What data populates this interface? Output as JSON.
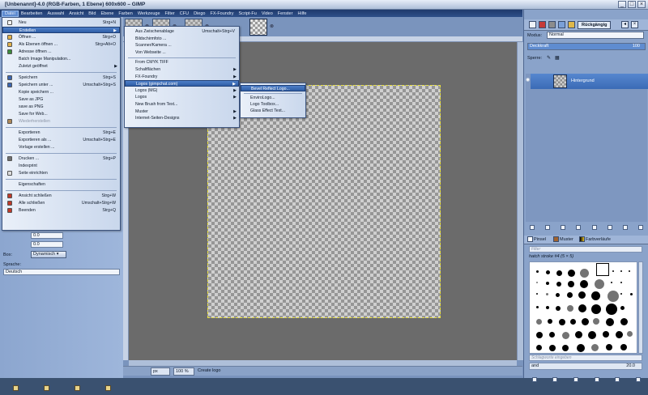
{
  "window": {
    "title": "[Unbenannt]-4.0 (RGB-Farben, 1 Ebene) 600x600 – GIMP",
    "buttons": [
      "_",
      "□",
      "×"
    ]
  },
  "menubar": [
    "Datei",
    "Bearbeiten",
    "Auswahl",
    "Ansicht",
    "Bild",
    "Ebene",
    "Farben",
    "Werkzeuge",
    "Filter",
    "CFU",
    "Diego",
    "FX-Foundry",
    "Script-Fu",
    "Video",
    "Fenster",
    "Hilfe"
  ],
  "file_menu": [
    {
      "label": "Neu",
      "acc": "Strg+N",
      "icon": "new-file-icon"
    },
    {
      "label": "Erstellen",
      "acc": "",
      "arrow": true,
      "highlighted": true
    },
    {
      "label": "Öffnen ...",
      "acc": "Strg+O",
      "icon": "open-folder-icon"
    },
    {
      "label": "Als Ebenen öffnen ...",
      "acc": "Strg+Alt+O",
      "icon": "open-layers-icon"
    },
    {
      "label": "Adresse öffnen ...",
      "acc": "",
      "icon": "globe-icon"
    },
    {
      "label": "Batch Image Manipulation...",
      "acc": ""
    },
    {
      "label": "Zuletzt geöffnet",
      "acc": "",
      "arrow": true
    },
    {
      "sep": true
    },
    {
      "label": "Speichern",
      "acc": "Strg+S",
      "icon": "save-icon"
    },
    {
      "label": "Speichern unter ...",
      "acc": "Umschalt+Strg+S",
      "icon": "save-as-icon"
    },
    {
      "label": "Kopie speichern ...",
      "acc": ""
    },
    {
      "label": "Save as JPG",
      "acc": ""
    },
    {
      "label": "save as PNG",
      "acc": ""
    },
    {
      "label": "Save for Web...",
      "acc": ""
    },
    {
      "label": "Wiederherstellen",
      "acc": "",
      "disabled": true,
      "icon": "revert-icon"
    },
    {
      "sep": true
    },
    {
      "label": "Exportieren",
      "acc": "Strg+E"
    },
    {
      "label": "Exportieren als ...",
      "acc": "Umschalt+Strg+E"
    },
    {
      "label": "Vorlage erstellen ...",
      "acc": ""
    },
    {
      "sep": true
    },
    {
      "label": "Drucken ...",
      "acc": "Strg+P",
      "icon": "print-icon"
    },
    {
      "label": "Indexprint",
      "acc": ""
    },
    {
      "label": "Seite einrichten",
      "acc": "",
      "icon": "page-setup-icon"
    },
    {
      "sep": true
    },
    {
      "label": "Eigenschaften",
      "acc": ""
    },
    {
      "sep": true
    },
    {
      "label": "Ansicht schließen",
      "acc": "Strg+W",
      "icon": "close-view-icon"
    },
    {
      "label": "Alle schließen",
      "acc": "Umschalt+Strg+W",
      "icon": "close-all-icon"
    },
    {
      "label": "Beenden",
      "acc": "Strg+Q",
      "icon": "quit-icon"
    }
  ],
  "create_menu": [
    {
      "label": "Aus Zwischenablage",
      "acc": "Umschalt+Strg+V"
    },
    {
      "label": "Bildschirmfoto ...",
      "acc": ""
    },
    {
      "label": "Scanner/Kamera ...",
      "acc": ""
    },
    {
      "label": "Von Webseite ...",
      "acc": ""
    },
    {
      "sep": true
    },
    {
      "label": "From CMYK TIFF",
      "acc": ""
    },
    {
      "label": "Schaltflächen",
      "acc": "",
      "arrow": true
    },
    {
      "label": "FX-Foundry",
      "acc": "",
      "arrow": true
    },
    {
      "label": "Logos (gimpchat.com)",
      "acc": "",
      "arrow": true,
      "highlighted": true
    },
    {
      "label": "Logos (MG)",
      "acc": "",
      "arrow": true
    },
    {
      "label": "Logos",
      "acc": "",
      "arrow": true
    },
    {
      "label": "New Brush from Text...",
      "acc": ""
    },
    {
      "label": "Muster",
      "acc": "",
      "arrow": true
    },
    {
      "label": "Internet-Seiten-Designs",
      "acc": "",
      "arrow": true
    }
  ],
  "logos_menu": [
    {
      "label": "Bevel Reflect Logo...",
      "highlighted": true
    },
    {
      "sep": true
    },
    {
      "label": "EnviroLogo..."
    },
    {
      "label": "Logo Toolbox..."
    },
    {
      "label": "Glass Effect Text..."
    }
  ],
  "left_dock": {
    "fields": [
      "0.0",
      "0.0"
    ],
    "box_label": "Box:",
    "box_value": "Dynamisch",
    "lang_label": "Sprache:",
    "lang_value": "Deutsch"
  },
  "status": {
    "unit": "px",
    "zoom": "100 %",
    "message": "Create logo"
  },
  "right_dock": {
    "undo_tab": "Rückgängig",
    "mode_label": "Modus:",
    "mode_value": "Normal",
    "opacity_label": "Deckkraft",
    "opacity_value": "100",
    "lock_label": "Sperre:",
    "layer_name": "Hintergrund",
    "brush_tabs": [
      "Pinsel",
      "Muster",
      "Farbverläufe"
    ],
    "filter_placeholder": "Filter",
    "brush_name": "hatch stroke #4 (5 × 5)",
    "tag_placeholder": "Schlagworte eingeben",
    "brush_current": "and",
    "brush_spacing": "20.0"
  },
  "colors": {
    "accent": "#2f5ea6",
    "menubar": "#1f3a6c",
    "canvas": "#6b6b6b"
  }
}
